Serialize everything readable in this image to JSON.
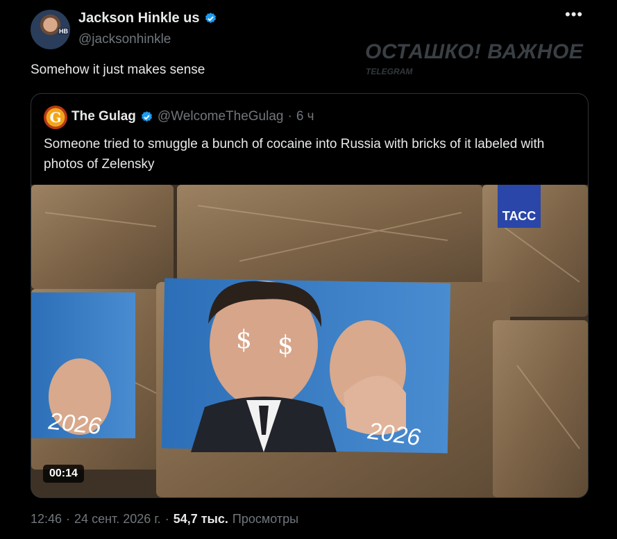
{
  "author": {
    "name": "Jackson Hinkle us",
    "handle": "@jacksonhinkle",
    "avatar_tag": "HB"
  },
  "menu_icon": "more-horizontal-icon",
  "tweet_text": "Somehow it just makes sense",
  "watermark": {
    "title": "ОСТАШКО! ВАЖНОЕ",
    "subtitle": "TELEGRAM"
  },
  "quoted": {
    "avatar_letter": "G",
    "name": "The Gulag",
    "handle": "@WelcomeTheGulag",
    "separator": "·",
    "time": "6 ч",
    "text": "Someone tried to smuggle a bunch of cocaine into Russia with bricks of it labeled with photos of Zelensky",
    "media": {
      "logo": "ТАСС",
      "duration": "00:14",
      "print_year": "2026",
      "print_symbol": "$"
    }
  },
  "footer": {
    "time": "12:46",
    "sep1": "·",
    "date": "24 сент. 2026 г.",
    "sep2": "·",
    "views_count": "54,7 тыс.",
    "views_label": "Просмотры"
  },
  "colors": {
    "background": "#000000",
    "text": "#e7e9ea",
    "muted": "#71767b",
    "verified": "#1d9bf0",
    "border": "#2f3336"
  }
}
